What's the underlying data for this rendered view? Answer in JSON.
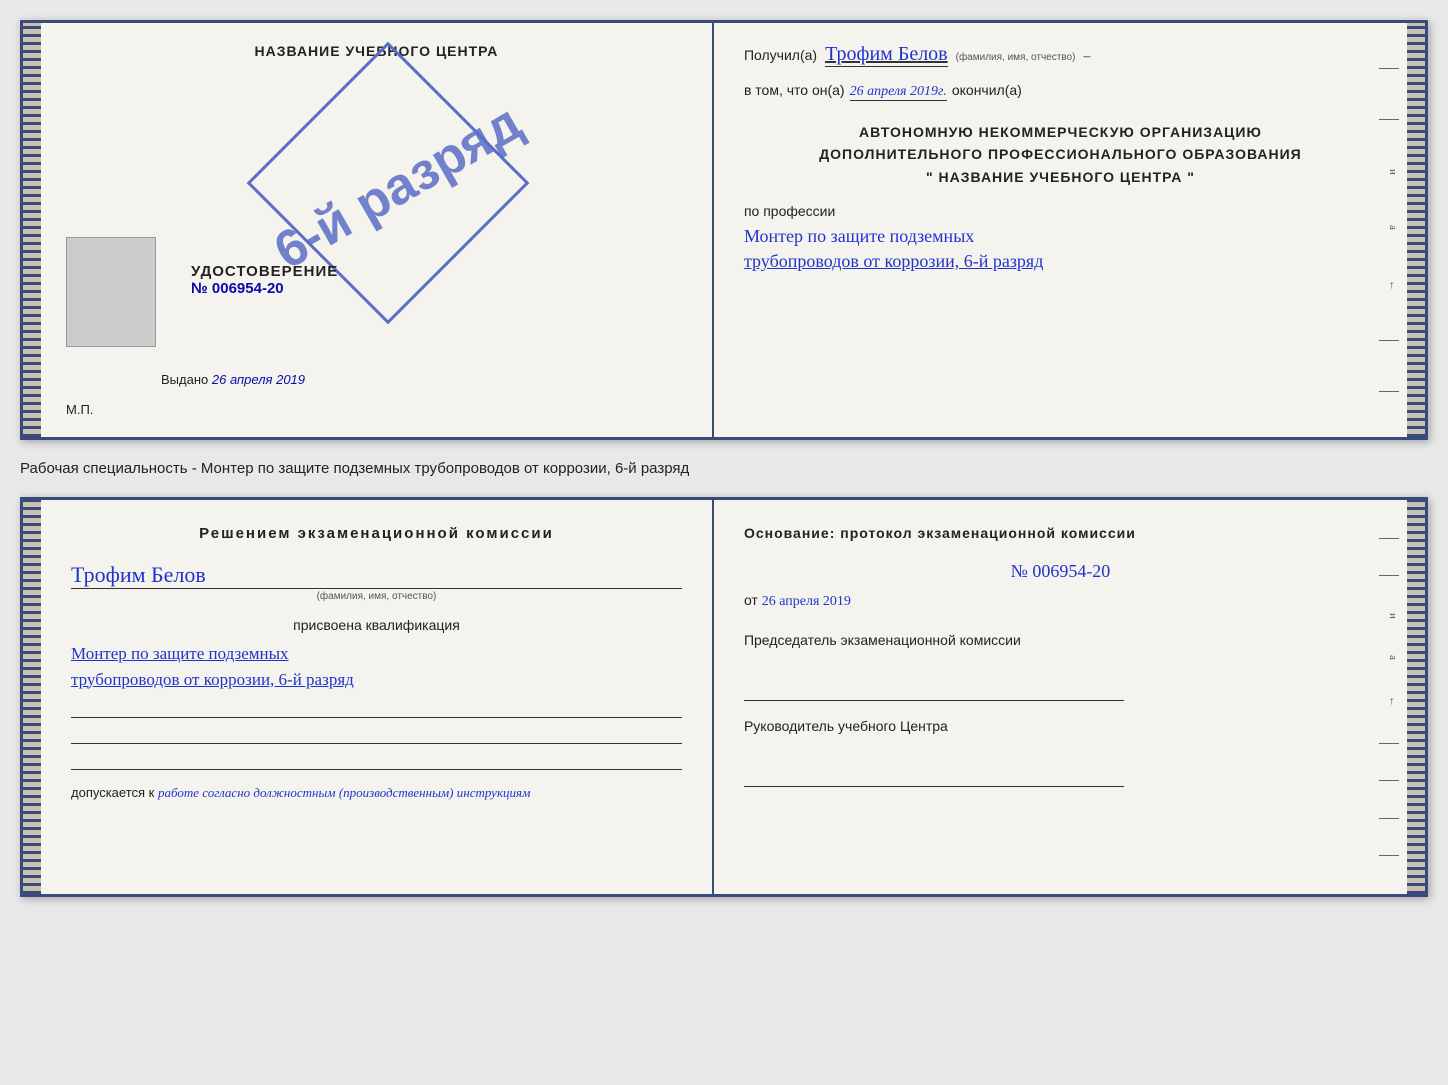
{
  "top_doc": {
    "left": {
      "heading": "НАЗВАНИЕ УЧЕБНОГО ЦЕНТРА",
      "stamp_text": "6-й разряд",
      "cert_label": "УДОСТОВЕРЕНИЕ",
      "cert_number": "№ 006954-20",
      "issued_prefix": "Выдано",
      "issued_date": "26 апреля 2019",
      "mp_label": "М.П."
    },
    "right": {
      "received_label": "Получил(а)",
      "person_name": "Трофим Белов",
      "person_subtitle": "(фамилия, имя, отчество)",
      "dash": "–",
      "date_prefix": "в том, что он(а)",
      "date_value": "26 апреля 2019г.",
      "date_suffix": "окончил(а)",
      "org_line1": "АВТОНОМНУЮ НЕКОММЕРЧЕСКУЮ ОРГАНИЗАЦИЮ",
      "org_line2": "ДОПОЛНИТЕЛЬНОГО ПРОФЕССИОНАЛЬНОГО ОБРАЗОВАНИЯ",
      "org_line3": "\" НАЗВАНИЕ УЧЕБНОГО ЦЕНТРА \"",
      "profession_label": "по профессии",
      "profession_hw1": "Монтер по защите подземных",
      "profession_hw2": "трубопроводов от коррозии, 6-й разряд"
    }
  },
  "specialty_bar": {
    "text": "Рабочая специальность - Монтер по защите подземных трубопроводов от коррозии, 6-й разряд"
  },
  "bottom_doc": {
    "left": {
      "decision_heading": "Решением экзаменационной комиссии",
      "person_name": "Трофим Белов",
      "person_subtitle": "(фамилия, имя, отчество)",
      "qualification_label": "присвоена квалификация",
      "qual_hw1": "Монтер по защите подземных",
      "qual_hw2": "трубопроводов от коррозии, 6-й разряд",
      "admitted_prefix": "допускается к",
      "admitted_hw": "работе согласно должностным (производственным) инструкциям"
    },
    "right": {
      "basis_heading": "Основание: протокол экзаменационной комиссии",
      "protocol_number": "№  006954-20",
      "from_prefix": "от",
      "from_date": "26 апреля 2019",
      "chairman_label": "Председатель экзаменационной комиссии",
      "director_label": "Руководитель учебного Центра"
    }
  }
}
